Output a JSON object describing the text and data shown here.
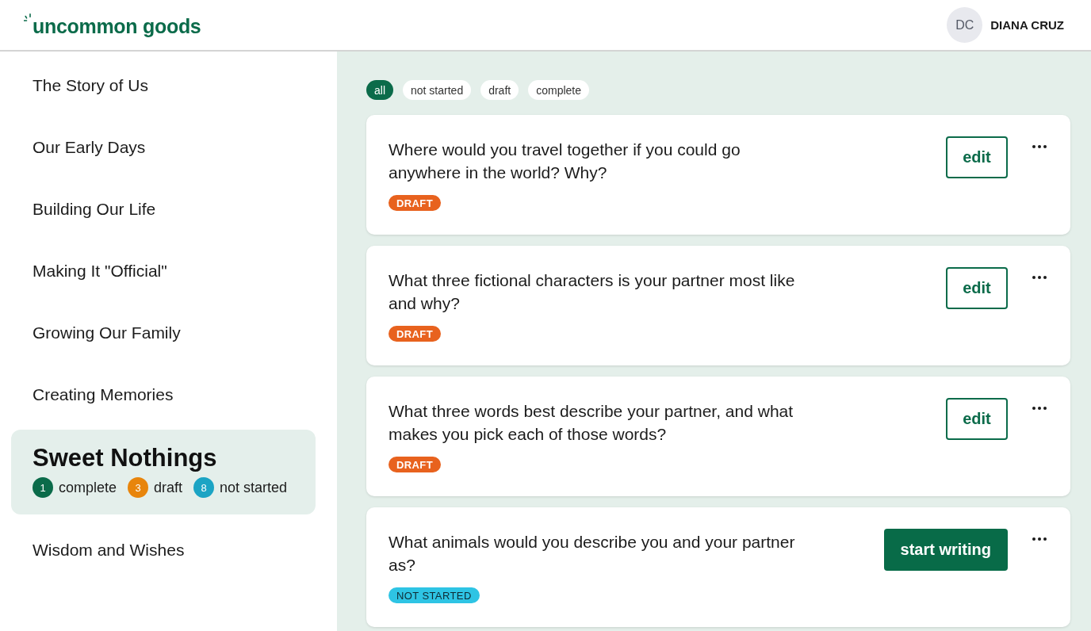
{
  "header": {
    "logo": "uncommon goods",
    "user": {
      "initials": "DC",
      "name": "DIANA CRUZ"
    }
  },
  "sidebar": {
    "items": [
      {
        "label": "The Story of Us",
        "selected": false
      },
      {
        "label": "Our Early Days",
        "selected": false
      },
      {
        "label": "Building Our Life",
        "selected": false
      },
      {
        "label": "Making It \"Official\"",
        "selected": false
      },
      {
        "label": "Growing Our Family",
        "selected": false
      },
      {
        "label": "Creating Memories",
        "selected": false
      },
      {
        "label": "Sweet Nothings",
        "selected": true,
        "counts": [
          {
            "count": "1",
            "label": "complete",
            "color": "#0b6b4a"
          },
          {
            "count": "3",
            "label": "draft",
            "color": "#e8850c"
          },
          {
            "count": "8",
            "label": "not started",
            "color": "#1ba4c4"
          }
        ]
      },
      {
        "label": "Wisdom and Wishes",
        "selected": false
      }
    ]
  },
  "filters": [
    {
      "label": "all",
      "selected": true
    },
    {
      "label": "not started",
      "selected": false
    },
    {
      "label": "draft",
      "selected": false
    },
    {
      "label": "complete",
      "selected": false
    }
  ],
  "questions": [
    {
      "text": "Where would you travel together if you could go anywhere in the world? Why?",
      "status": {
        "label": "DRAFT",
        "kind": "draft"
      },
      "action": {
        "label": "edit",
        "kind": "outline"
      }
    },
    {
      "text": "What three fictional characters is your partner most like and why?",
      "status": {
        "label": "DRAFT",
        "kind": "draft"
      },
      "action": {
        "label": "edit",
        "kind": "outline"
      }
    },
    {
      "text": "What three words best describe your partner, and what makes you pick each of those words?",
      "status": {
        "label": "DRAFT",
        "kind": "draft"
      },
      "action": {
        "label": "edit",
        "kind": "outline"
      }
    },
    {
      "text": "What animals would you describe you and your partner as?",
      "status": {
        "label": "NOT STARTED",
        "kind": "not_started"
      },
      "action": {
        "label": "start writing",
        "kind": "primary"
      }
    }
  ]
}
